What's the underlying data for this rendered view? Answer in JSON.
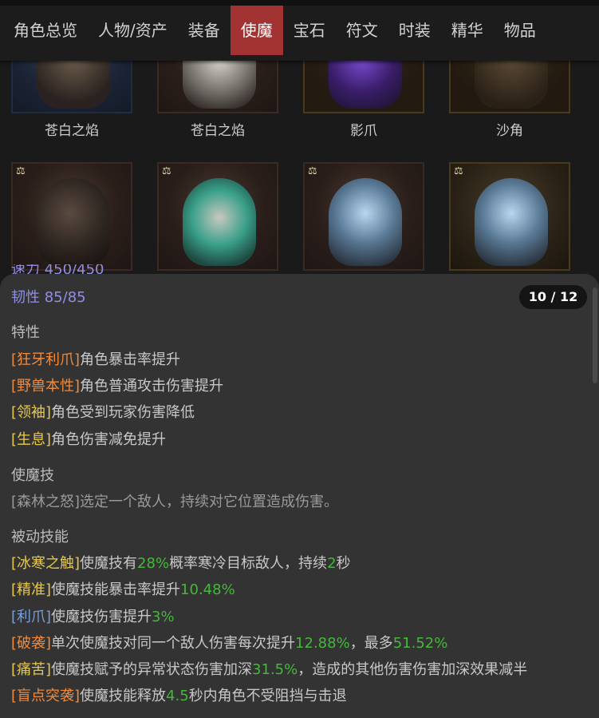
{
  "tabs": [
    {
      "label": "角色总览"
    },
    {
      "label": "人物/资产"
    },
    {
      "label": "装备"
    },
    {
      "label": "使魔",
      "active": true
    },
    {
      "label": "宝石"
    },
    {
      "label": "符文"
    },
    {
      "label": "时装"
    },
    {
      "label": "精华"
    },
    {
      "label": "物品"
    }
  ],
  "familiars_row1": [
    {
      "name": "苍白之焰",
      "icon": "raven-helm-icon",
      "color": "#2a3a55"
    },
    {
      "name": "苍白之焰",
      "icon": "white-owl-icon",
      "color": "#4a2a22"
    },
    {
      "name": "影爪",
      "icon": "shadow-claw-icon",
      "color": "#3c2a55"
    },
    {
      "name": "沙角",
      "icon": "sand-horn-icon",
      "color": "#4a3a1a"
    }
  ],
  "familiars_row2": [
    {
      "icon": "raven-helm-icon",
      "scale_icon": "⚖",
      "color": "#4a2a22"
    },
    {
      "icon": "cat-spirit-icon",
      "scale_icon": "⚖",
      "color": "#4a2a22"
    },
    {
      "icon": "ice-helm-icon",
      "scale_icon": "⚖",
      "color": "#4a2a22"
    },
    {
      "icon": "ice-helm-icon",
      "scale_icon": "⚖",
      "color": "#4a3a1a"
    }
  ],
  "panel": {
    "peek_text": "速力 450/450",
    "toughness": "韧性 85/85",
    "pager": "10 / 12",
    "traits_title": "特性",
    "traits": [
      {
        "tag": "[狂牙利爪]",
        "text": "角色暴击率提升"
      },
      {
        "tag": "[野兽本性]",
        "text": "角色普通攻击伤害提升"
      },
      {
        "tag": "[领袖]",
        "text": "角色受到玩家伤害降低"
      },
      {
        "tag": "[生息]",
        "text": "角色伤害减免提升"
      }
    ],
    "skill_title": "使魔技",
    "skill": {
      "tag": "[森林之怒]",
      "text": "选定一个敌人，持续对它位置造成伤害。"
    },
    "passive_title": "被动技能",
    "passives": [
      {
        "tag": "[冰寒之触]",
        "a": "使魔技有",
        "v1": "28%",
        "b": "概率寒冷目标敌人，持续",
        "v2": "2",
        "c": "秒"
      },
      {
        "tag": "[精准]",
        "a": "使魔技能暴击率提升",
        "v1": "10.48%"
      },
      {
        "tag": "[利爪]",
        "a": "使魔技伤害提升",
        "v1": "3%"
      },
      {
        "tag": "[破袭]",
        "a": "单次使魔技对同一个敌人伤害每次提升",
        "v1": "12.88%",
        "b": "，最多",
        "v2": "51.52%"
      },
      {
        "tag": "[痛苦]",
        "a": "使魔技赋予的异常状态伤害加深",
        "v1": "31.5%",
        "b": "，造成的其他伤害伤害加深效果减半"
      },
      {
        "tag": "[盲点突袭]",
        "a": "使魔技能释放",
        "v1": "4.5",
        "b": "秒内角色不受阻挡与击退"
      }
    ]
  },
  "colors": {
    "accent": "#a33333",
    "orange_tag": "#f08a3c",
    "yellow_tag": "#e8c84a",
    "blue_tag": "#7b9ed6",
    "value_green": "#44b83a",
    "stat_purple": "#8f8fe8"
  }
}
